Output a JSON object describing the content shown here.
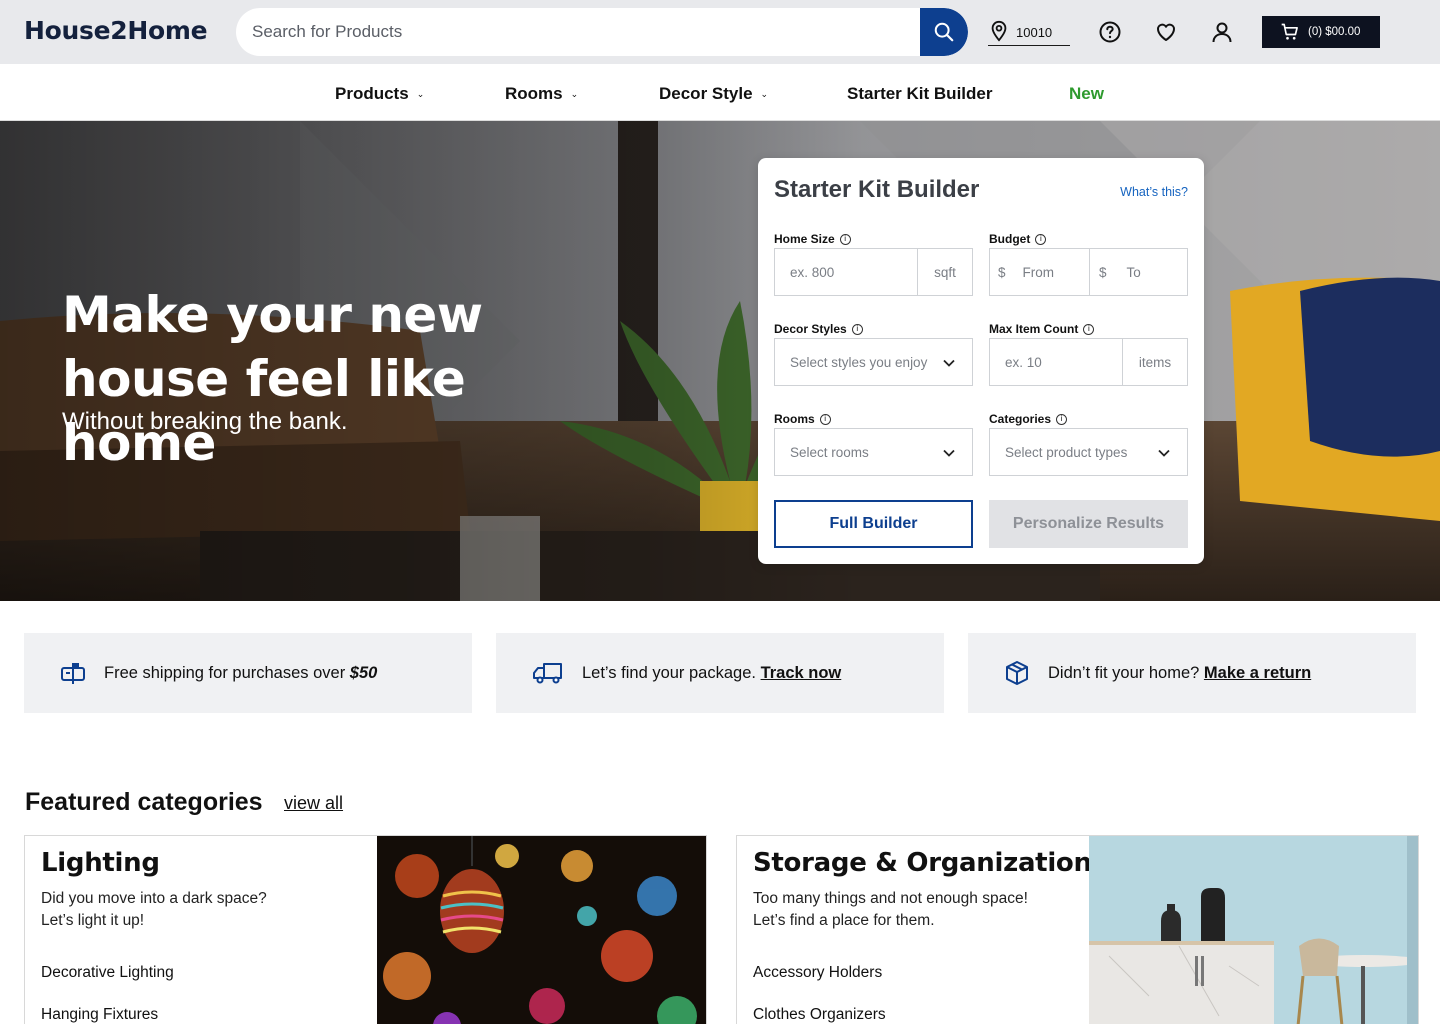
{
  "header": {
    "logo": "House2Home",
    "search_placeholder": "Search for Products",
    "zip": "10010",
    "cart_label": "(0) $00.00"
  },
  "nav": {
    "products": "Products",
    "rooms": "Rooms",
    "decor_style": "Decor Style",
    "starter_kit": "Starter Kit Builder",
    "new": "New"
  },
  "hero": {
    "title_line1": "Make your new",
    "title_line2": "house feel like home",
    "subtitle": "Without breaking the bank."
  },
  "builder": {
    "title": "Starter Kit Builder",
    "whats_this": "What’s this?",
    "home_size": {
      "label": "Home Size",
      "placeholder": "ex. 800",
      "unit": "sqft"
    },
    "budget": {
      "label": "Budget",
      "currency": "$",
      "from": "From",
      "to": "To"
    },
    "decor_styles": {
      "label": "Decor Styles",
      "placeholder": "Select styles you enjoy"
    },
    "max_item_count": {
      "label": "Max Item Count",
      "placeholder": "ex. 10",
      "unit": "items"
    },
    "rooms": {
      "label": "Rooms",
      "placeholder": "Select rooms"
    },
    "categories": {
      "label": "Categories",
      "placeholder": "Select product types"
    },
    "full_builder": "Full Builder",
    "personalize": "Personalize Results"
  },
  "strips": {
    "shipping_text": "Free shipping for purchases over ",
    "shipping_amount": "$50",
    "track_text": "Let’s find your package. ",
    "track_link": "Track now",
    "return_text": "Didn’t fit your home? ",
    "return_link": "Make a return"
  },
  "featured": {
    "title": "Featured categories",
    "view_all": "view all",
    "categories": [
      {
        "name": "Lighting",
        "desc_line1": "Did you move into a dark space?",
        "desc_line2": "Let’s light it up!",
        "link1": "Decorative Lighting",
        "link2": "Hanging Fixtures"
      },
      {
        "name": "Storage & Organization",
        "desc_line1": "Too many things and not enough space!",
        "desc_line2": "Let’s find a place for them.",
        "link1": "Accessory Holders",
        "link2": "Clothes Organizers"
      }
    ]
  },
  "colors": {
    "primary": "#0d3f8f",
    "new_green": "#2e9a2e",
    "topbar": "#e8e9ec",
    "cart_bg": "#0d1220"
  }
}
